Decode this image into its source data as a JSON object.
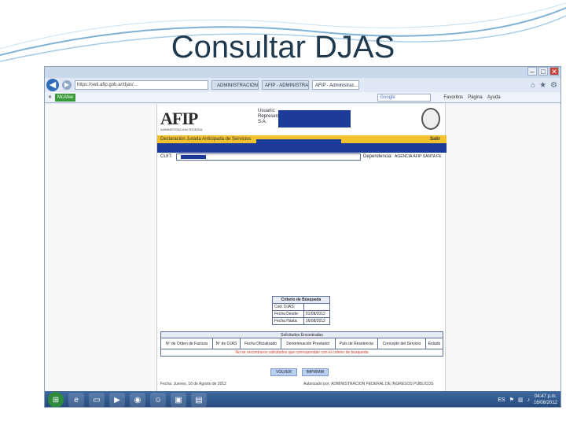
{
  "slide": {
    "title": "Consultar DJAS"
  },
  "browser": {
    "window_buttons": [
      "–",
      "□",
      "✕"
    ],
    "back_label": "◀",
    "forward_label": "▶",
    "address": "https://seti.afip.gob.ar/djas/...",
    "tabs": [
      {
        "label": ": ADMINISTRACION FEDERAL ..."
      },
      {
        "label": "AFIP - ADMINISTRACION FEDE..."
      },
      {
        "label": "AFIP - Administrac..."
      }
    ],
    "toolbar_mcafee": "McAfee",
    "search_engine": "Google",
    "toolbar_items": [
      "Favoritos",
      "Página",
      "Ayuda"
    ]
  },
  "afip": {
    "logo_text": "AFIP",
    "logo_sub": "ADMINISTRACION FEDERAL",
    "user_label": "Usuario:",
    "rep_label": "Representado:",
    "sa_label": "S.A.",
    "system_bar": "Declaración Jurada Anticipada de Servicios",
    "salir": "Salir",
    "cuit_label": "CUIT:",
    "dependencia_label": "Dependencia:",
    "dependencia_value": "AGENCIA AFIP SANTA FE"
  },
  "criterio": {
    "title": "Criterio de Búsqueda",
    "rows": [
      {
        "label": "Cod. DJAS:",
        "value": ""
      },
      {
        "label": "Fecha Desde:",
        "value": "01/08/2012"
      },
      {
        "label": "Fecha Hasta:",
        "value": "16/08/2012"
      }
    ]
  },
  "solicitudes": {
    "title": "Solicitudes Encontradas",
    "columns": [
      "Nº de Orden de Factura",
      "Nº de DJAS",
      "Fecha Oficializado",
      "Denominación Prestador",
      "País de Residencia",
      "Concepto del Servicio",
      "Estado"
    ],
    "empty_message": "No se encontraron solicitudes que correspondan con el criterio de busqueda"
  },
  "buttons": {
    "volver": "VOLVER",
    "imprimir": "IMPRIMIR"
  },
  "footer": {
    "date": "Fecha: Jueves, 16 de Agosto de 2012",
    "authorized": "Autorizado por: ADMINISTRACION FEDERAL DE INGRESOS PUBLICOS"
  },
  "taskbar": {
    "time": "04:47 p.m.",
    "date": "16/08/2012",
    "lang": "ES"
  }
}
